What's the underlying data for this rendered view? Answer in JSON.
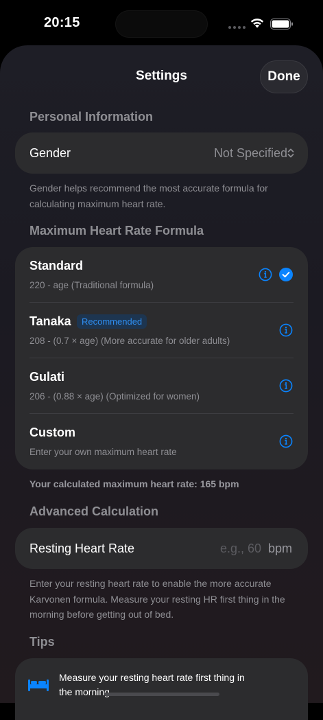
{
  "status": {
    "time": "20:15"
  },
  "header": {
    "title": "Settings",
    "done_label": "Done"
  },
  "personal": {
    "section_title": "Personal Information",
    "gender_label": "Gender",
    "gender_value": "Not Specified",
    "footnote": "Gender helps recommend the most accurate formula for calculating maximum heart rate."
  },
  "formula": {
    "section_title": "Maximum Heart Rate Formula",
    "options": [
      {
        "name": "Standard",
        "desc": "220 - age (Traditional formula)",
        "selected": true
      },
      {
        "name": "Tanaka",
        "badge": "Recommended",
        "desc": "208 - (0.7 × age) (More accurate for older adults)",
        "selected": false
      },
      {
        "name": "Gulati",
        "desc": "206 - (0.88 × age) (Optimized for women)",
        "selected": false
      },
      {
        "name": "Custom",
        "desc": "Enter your own maximum heart rate",
        "selected": false
      }
    ],
    "calculated": "Your calculated maximum heart rate: 165 bpm"
  },
  "advanced": {
    "section_title": "Advanced Calculation",
    "resting_label": "Resting Heart Rate",
    "resting_placeholder": "e.g., 60",
    "resting_unit": "bpm",
    "footnote": "Enter your resting heart rate to enable the more accurate Karvonen formula. Measure your resting HR first thing in the morning before getting out of bed."
  },
  "tips": {
    "section_title": "Tips",
    "items": [
      {
        "icon": "bed-icon",
        "text": "Measure your resting heart rate first thing in the morning"
      }
    ]
  },
  "colors": {
    "accent": "#0a84ff",
    "card": "#2c2c2e",
    "secondary_text": "#8e8e93"
  }
}
